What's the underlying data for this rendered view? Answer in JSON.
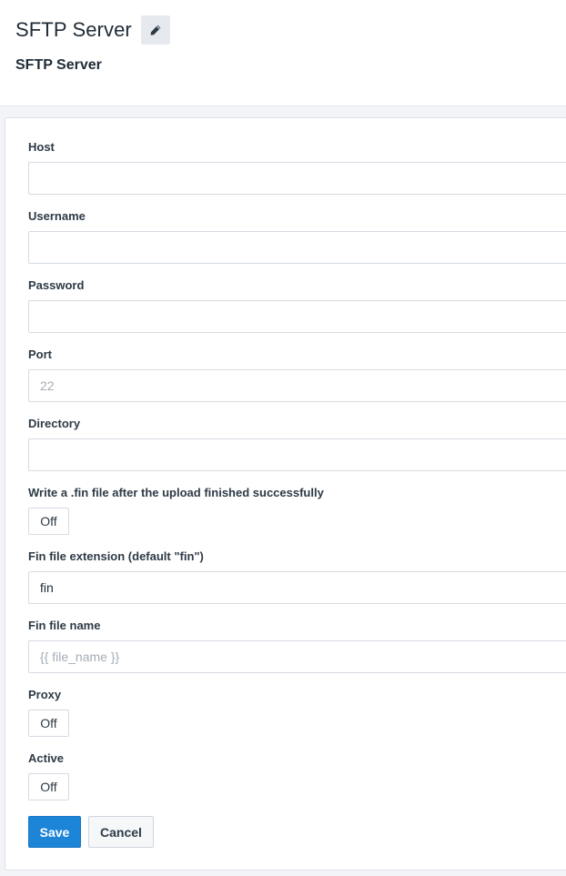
{
  "header": {
    "title": "SFTP Server",
    "subtitle": "SFTP Server",
    "edit_icon": "pencil-icon"
  },
  "form": {
    "host": {
      "label": "Host",
      "value": "",
      "placeholder": ""
    },
    "username": {
      "label": "Username",
      "value": "",
      "placeholder": ""
    },
    "password": {
      "label": "Password",
      "value": "",
      "placeholder": ""
    },
    "port": {
      "label": "Port",
      "value": "",
      "placeholder": "22"
    },
    "directory": {
      "label": "Directory",
      "value": "",
      "placeholder": ""
    },
    "write_fin": {
      "label": "Write a .fin file after the upload finished successfully",
      "state": "Off"
    },
    "fin_extension": {
      "label": "Fin file extension (default \"fin\")",
      "value": "fin",
      "placeholder": ""
    },
    "fin_name": {
      "label": "Fin file name",
      "value": "",
      "placeholder": "{{ file_name }}"
    },
    "proxy": {
      "label": "Proxy",
      "state": "Off"
    },
    "active": {
      "label": "Active",
      "state": "Off"
    }
  },
  "actions": {
    "save_label": "Save",
    "cancel_label": "Cancel"
  },
  "colors": {
    "primary": "#1d85d8",
    "background": "#f2f4f7",
    "border": "#d5dbe2",
    "text": "#1f2b37"
  }
}
